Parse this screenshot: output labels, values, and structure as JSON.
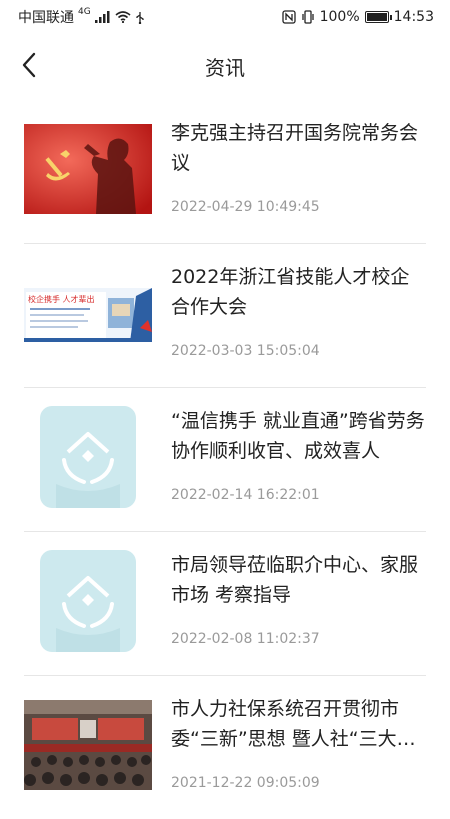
{
  "status_bar": {
    "carrier": "中国联通",
    "network": "4G",
    "battery": "100%",
    "time": "14:53"
  },
  "header": {
    "title": "资讯",
    "back_icon": "chevron-left-icon"
  },
  "articles": [
    {
      "title": "李克强主持召开国务院常务会议",
      "date": "2022-04-29 10:49:45"
    },
    {
      "title": "2022年浙江省技能人才校企合作大会",
      "date": "2022-03-03 15:05:04",
      "thumb_text": "校企携手 人才辈出"
    },
    {
      "title": "“温信携手 就业直通”跨省劳务协作顺利收官、成效喜人",
      "date": "2022-02-14 16:22:01"
    },
    {
      "title": "市局领导莅临职介中心、家服市场 考察指导",
      "date": "2022-02-08 11:02:37"
    },
    {
      "title": "市人力社保系统召开贯彻市委“三新”思想 暨人社“三大…",
      "date": "2021-12-22 09:05:09"
    }
  ],
  "colors": {
    "placeholder_bg": "#cde9ee",
    "date_gray": "#9a9a9a",
    "divider": "#e6e6e6"
  }
}
